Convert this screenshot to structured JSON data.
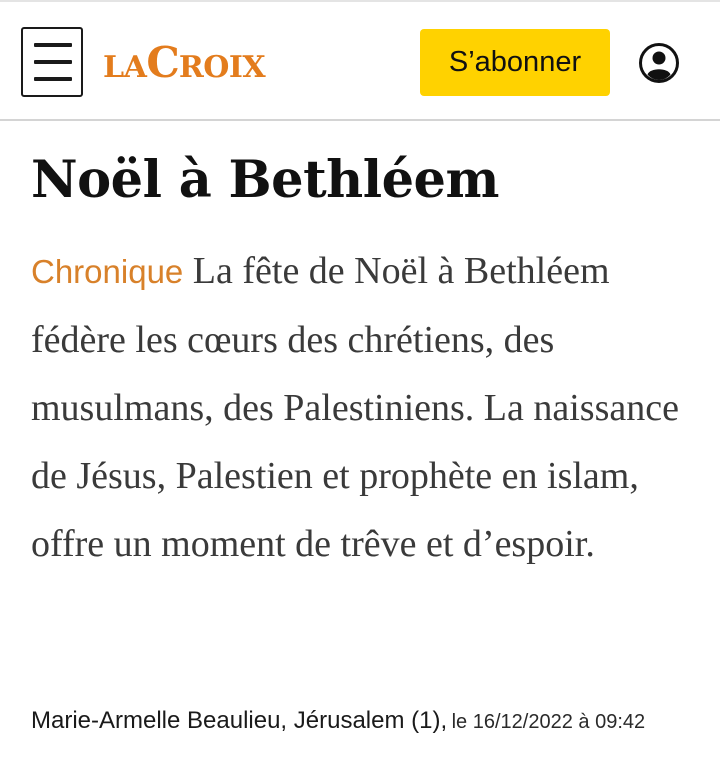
{
  "header": {
    "logo_small_1": "LA",
    "logo_big": "C",
    "logo_small_2": "ROIX",
    "subscribe_label": "S’abonner",
    "account_icon": "user-circle-icon",
    "menu_icon": "hamburger-icon",
    "brand_color": "#e37c1d",
    "button_color": "#ffd200"
  },
  "article": {
    "title": "Noël à Bethléem",
    "rubric": "Chronique",
    "lede": "La fête de Noël à Bethléem fédère les cœurs des chrétiens, des musulmans, des Palestiniens. La naissance de Jésus, Palestien et prophète en islam, offre un moment de trêve et d’espoir.",
    "author": "Marie-Armelle Beaulieu, Jérusalem (1),",
    "date": "le 16/12/2022 à 09:42",
    "rubric_color": "#d8812a"
  }
}
